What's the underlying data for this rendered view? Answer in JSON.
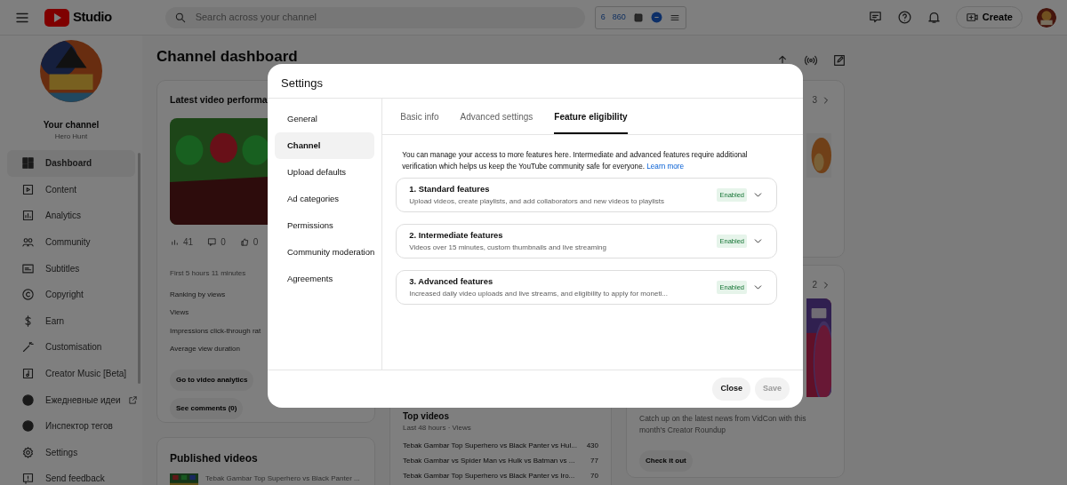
{
  "header": {
    "logo_text": "Studio",
    "search_placeholder": "Search across your channel",
    "extension_values": [
      "6",
      "860"
    ],
    "create_label": "Create"
  },
  "sidebar": {
    "channel_title": "Your channel",
    "channel_name": "Hero Hunt",
    "items": [
      {
        "label": "Dashboard",
        "selected": true,
        "external": false
      },
      {
        "label": "Content",
        "selected": false,
        "external": false
      },
      {
        "label": "Analytics",
        "selected": false,
        "external": false
      },
      {
        "label": "Community",
        "selected": false,
        "external": false
      },
      {
        "label": "Subtitles",
        "selected": false,
        "external": false
      },
      {
        "label": "Copyright",
        "selected": false,
        "external": false
      },
      {
        "label": "Earn",
        "selected": false,
        "external": false
      },
      {
        "label": "Customisation",
        "selected": false,
        "external": false
      },
      {
        "label": "Creator Music [Beta]",
        "selected": false,
        "external": false
      },
      {
        "label": "Ежедневные идеи",
        "selected": false,
        "external": true
      },
      {
        "label": "Инспектор тегов",
        "selected": false,
        "external": false
      },
      {
        "label": "Settings",
        "selected": false,
        "external": false
      },
      {
        "label": "Send feedback",
        "selected": false,
        "external": false
      }
    ]
  },
  "main": {
    "title": "Channel dashboard",
    "latest": {
      "title": "Latest video performa",
      "stats": [
        "41",
        "0",
        "0"
      ],
      "period": "First 5 hours 11 minutes",
      "metrics": [
        "Ranking by views",
        "Views",
        "Impressions click-through rat",
        "Average view duration"
      ],
      "buttons": [
        "Go to video analytics",
        "See comments (0)"
      ]
    },
    "published": {
      "title": "Published videos",
      "video_title": "Tebak Gambar Top Superhero vs Black Panter ..."
    },
    "top_videos": {
      "title": "Top videos",
      "subtitle": "Last 48 hours · Views",
      "rows": [
        {
          "title": "Tebak Gambar Top Superhero vs Black Panter vs Hul...",
          "views": "430"
        },
        {
          "title": "Tebak Gambar vs Spider Man vs Hulk vs Batman vs ...",
          "views": "77"
        },
        {
          "title": "Tebak Gambar Top Superhero vs Black Panter vs Iro...",
          "views": "70"
        }
      ]
    },
    "news_top": {
      "pager": "3"
    },
    "news": {
      "pager": "2",
      "description": "Catch up on the latest news from VidCon with this month's Creator Roundup",
      "button": "Check it out"
    }
  },
  "modal": {
    "title": "Settings",
    "nav": [
      {
        "label": "General",
        "selected": false
      },
      {
        "label": "Channel",
        "selected": true
      },
      {
        "label": "Upload defaults",
        "selected": false
      },
      {
        "label": "Ad categories",
        "selected": false
      },
      {
        "label": "Permissions",
        "selected": false
      },
      {
        "label": "Community moderation",
        "selected": false
      },
      {
        "label": "Agreements",
        "selected": false
      }
    ],
    "tabs": [
      {
        "label": "Basic info",
        "selected": false
      },
      {
        "label": "Advanced settings",
        "selected": false
      },
      {
        "label": "Feature eligibility",
        "selected": true
      }
    ],
    "intro": "You can manage your access to more features here. Intermediate and advanced features require additional verification which helps us keep the YouTube community safe for everyone.",
    "learn_more": "Learn more",
    "features": [
      {
        "title": "1. Standard features",
        "description": "Upload videos, create playlists, and add collaborators and new videos to playlists",
        "status": "Enabled",
        "expanded": false
      },
      {
        "title": "2. Intermediate features",
        "description": "Videos over 15 minutes, custom thumbnails and live streaming",
        "status": "Enabled",
        "expanded": false
      },
      {
        "title": "3. Advanced features",
        "description": "Increased daily video uploads and live streams, and eligibility to apply for moneti...",
        "status": "Enabled",
        "expanded": false
      }
    ],
    "buttons": [
      {
        "label": "Close",
        "disabled": false
      },
      {
        "label": "Save",
        "disabled": true
      }
    ]
  }
}
